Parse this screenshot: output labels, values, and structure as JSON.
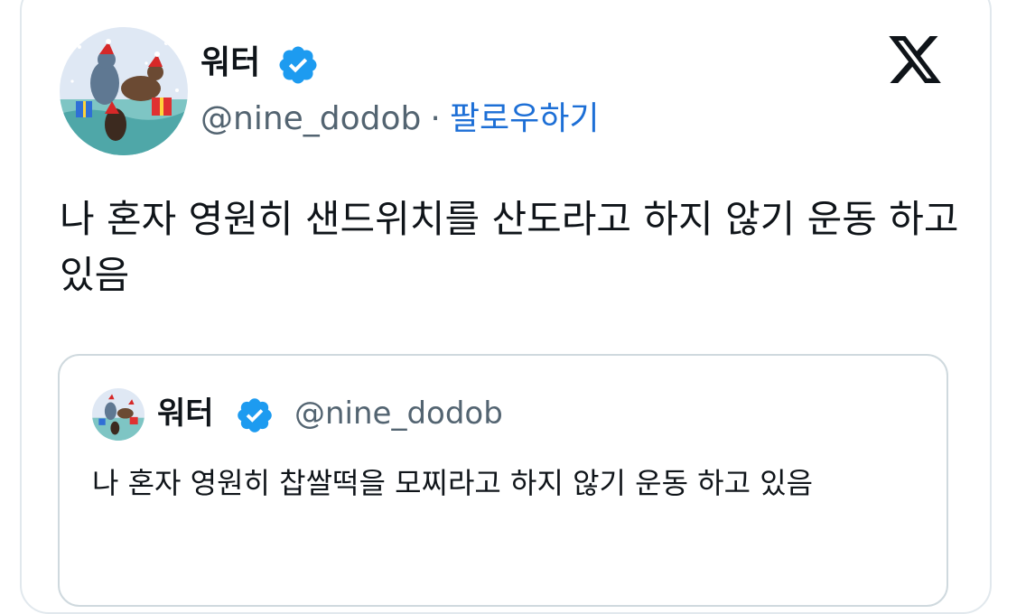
{
  "tweet": {
    "author": {
      "display_name": "워터",
      "handle": "@nine_dodob",
      "verified": true,
      "avatar_icon": "christmas-avatar"
    },
    "separator": "·",
    "follow_label": "팔로우하기",
    "text": "나 혼자 영원히 샌드위치를 산도라고 하지 않기 운동 하고 있음",
    "brand_icon": "x-logo-icon"
  },
  "quoted_tweet": {
    "author": {
      "display_name": "워터",
      "handle": "@nine_dodob",
      "verified": true
    },
    "text": "나 혼자 영원히 찹쌀떡을 모찌라고 하지 않기 운동 하고 있음"
  },
  "colors": {
    "verified_badge": "#1d9bf0",
    "link": "#1d6fd6",
    "secondary_text": "#536471",
    "border": "#cfd9de"
  }
}
